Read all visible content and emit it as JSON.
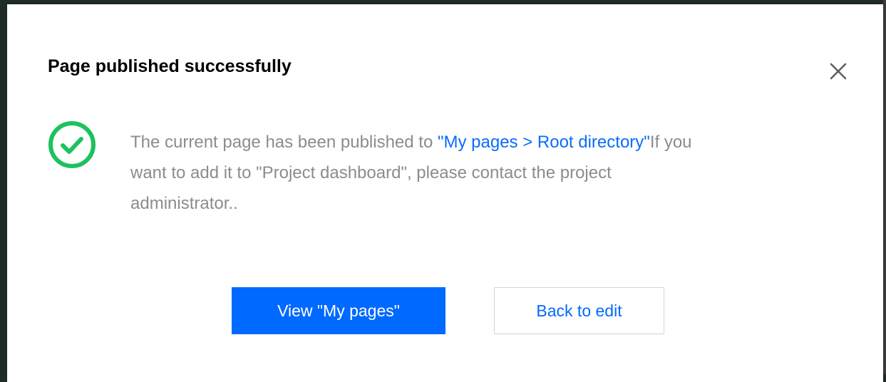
{
  "dialog": {
    "title": "Page published successfully",
    "close_icon": "close-icon",
    "status_icon": "check-circle-icon",
    "status_color": "#1ec15f",
    "message": {
      "text_before": "The current page has been published to ",
      "link_text": "\"My pages > Root directory\"",
      "text_after": "If you want to add it to \"Project dashboard\", please contact the project administrator.."
    },
    "buttons": {
      "primary_label": "View \"My pages\"",
      "secondary_label": "Back to edit"
    },
    "accent_color": "#0069ff"
  }
}
